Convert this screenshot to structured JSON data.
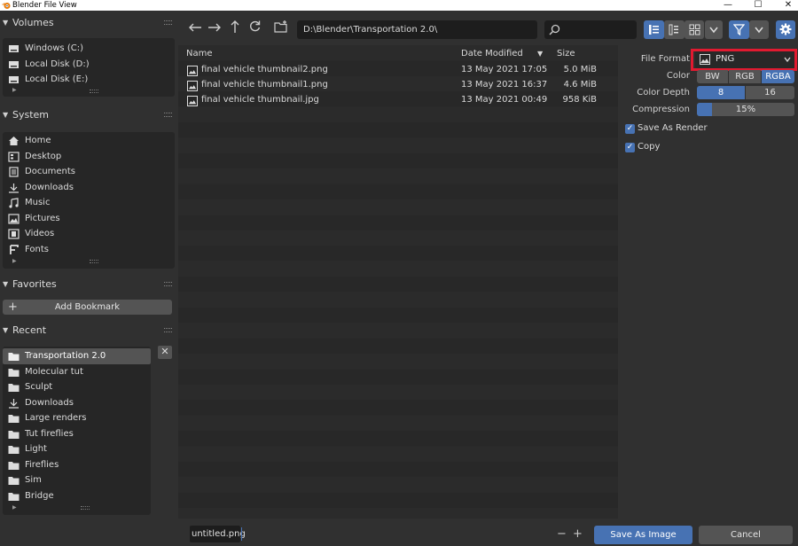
{
  "window": {
    "title": "Blender File View",
    "minimize": "—",
    "maximize": "☐",
    "close": "✕"
  },
  "sidebar": {
    "volumes": {
      "title": "Volumes",
      "items": [
        "Windows (C:)",
        "Local Disk (D:)",
        "Local Disk (E:)"
      ]
    },
    "system": {
      "title": "System",
      "items": [
        "Home",
        "Desktop",
        "Documents",
        "Downloads",
        "Music",
        "Pictures",
        "Videos",
        "Fonts"
      ]
    },
    "favorites": {
      "title": "Favorites",
      "add_bookmark": "Add Bookmark"
    },
    "recent": {
      "title": "Recent",
      "items": [
        "Transportation 2.0",
        "Molecular tut",
        "Sculpt",
        "Downloads",
        "Large renders",
        "Tut fireflies",
        "Light",
        "Fireflies",
        "Sim",
        "Bridge"
      ]
    }
  },
  "toolbar": {
    "path": "D:\\Blender\\Transportation 2.0\\",
    "search_placeholder": ""
  },
  "filelist": {
    "columns": {
      "name": "Name",
      "date": "Date Modified",
      "size": "Size"
    },
    "rows": [
      {
        "name": "final vehicle thumbnail2.png",
        "date": "13 May 2021 17:05",
        "size": "5.0 MiB"
      },
      {
        "name": "final vehicle thumbnail1.png",
        "date": "13 May 2021 16:37",
        "size": "4.6 MiB"
      },
      {
        "name": "final vehicle thumbnail.jpg",
        "date": "13 May 2021 00:49",
        "size": "958 KiB"
      }
    ]
  },
  "options": {
    "file_format_label": "File Format",
    "file_format_value": "PNG",
    "color_label": "Color",
    "color_options": [
      "BW",
      "RGB",
      "RGBA"
    ],
    "color_selected": "RGBA",
    "color_depth_label": "Color Depth",
    "color_depth_options": [
      "8",
      "16"
    ],
    "color_depth_selected": "8",
    "compression_label": "Compression",
    "compression_value": "15%",
    "compression_fraction": 0.15,
    "save_as_render": "Save As Render",
    "copy": "Copy"
  },
  "bottom": {
    "filename": "untitled.png",
    "minus": "−",
    "plus": "+",
    "save_button": "Save As Image",
    "cancel_button": "Cancel"
  },
  "colors": {
    "accent": "#4772b3",
    "highlight_box": "#e11a30"
  }
}
